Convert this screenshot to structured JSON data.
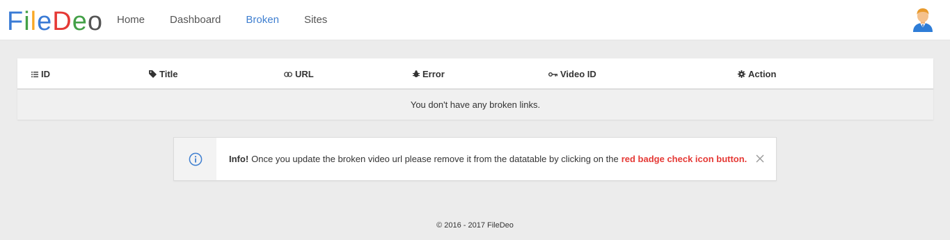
{
  "brand": {
    "letters": [
      {
        "char": "F",
        "color": "#3a7bd5"
      },
      {
        "char": "i",
        "color": "#43a047"
      },
      {
        "char": "l",
        "color": "#f9a825"
      },
      {
        "char": "e",
        "color": "#3a7bd5"
      },
      {
        "char": "D",
        "color": "#e53935"
      },
      {
        "char": "e",
        "color": "#43a047"
      },
      {
        "char": "o",
        "color": "#555555"
      }
    ]
  },
  "nav": {
    "home": "Home",
    "dashboard": "Dashboard",
    "broken": "Broken",
    "sites": "Sites",
    "active": "Broken"
  },
  "table": {
    "columns": {
      "id": "ID",
      "title": "Title",
      "url": "URL",
      "error": "Error",
      "video_id": "Video ID",
      "action": "Action"
    },
    "empty_message": "You don't have any broken links."
  },
  "alert": {
    "label": "Info!",
    "message": "Once you update the broken video url please remove it from the datatable by clicking on the",
    "highlight": "red badge check icon button."
  },
  "footer": {
    "text": "© 2016 - 2017 FileDeo"
  },
  "colors": {
    "accent": "#3f7fd0",
    "danger": "#e53935"
  }
}
